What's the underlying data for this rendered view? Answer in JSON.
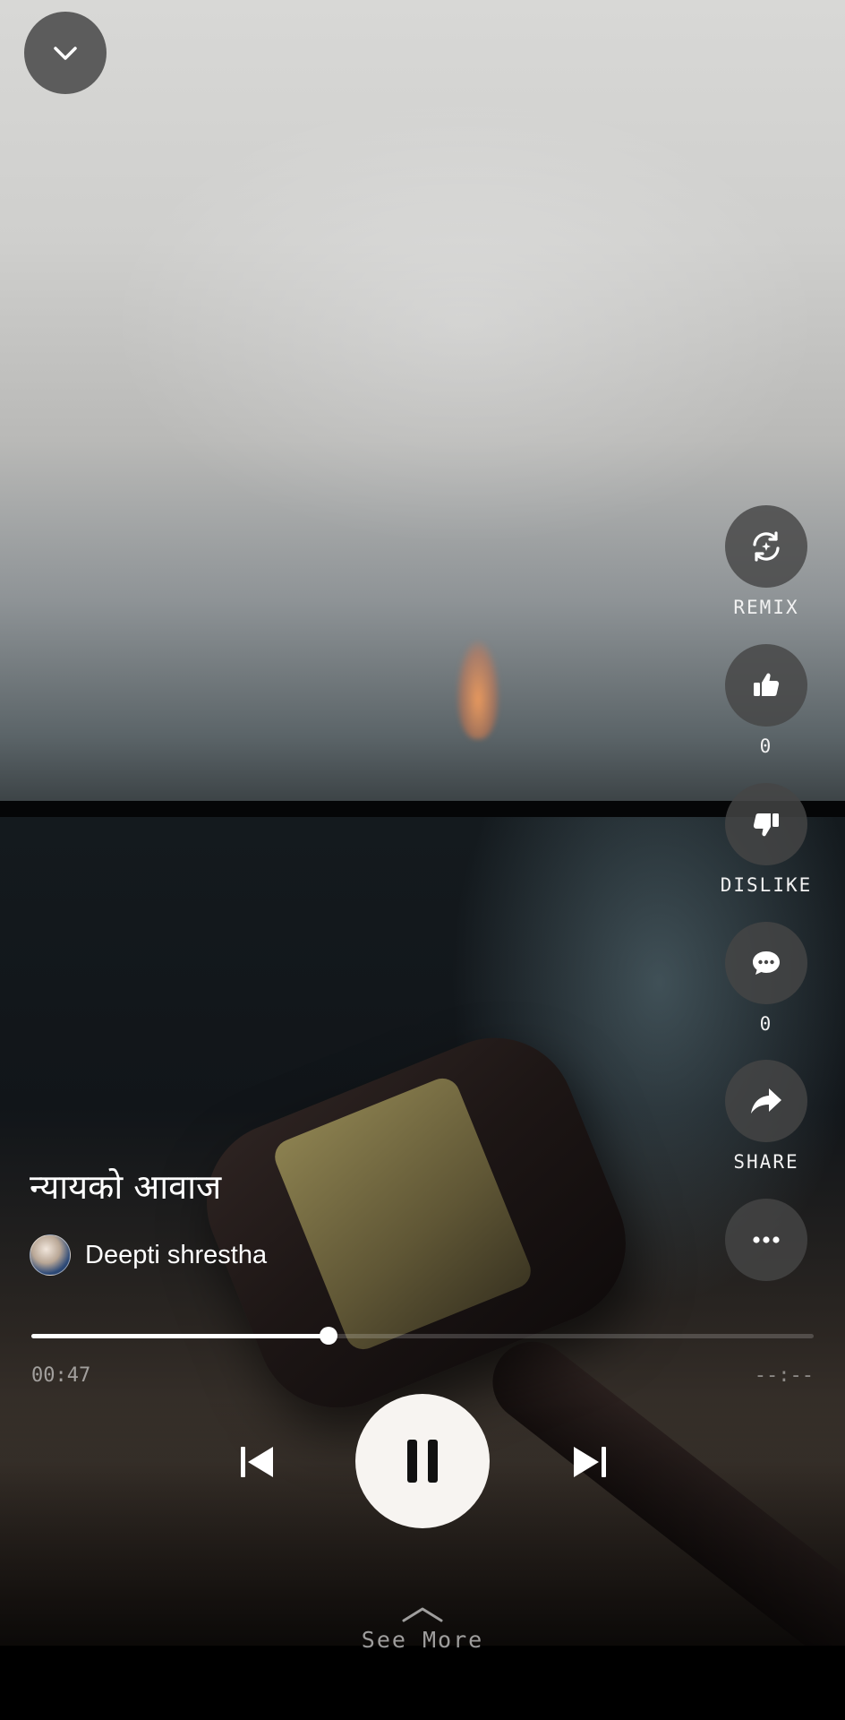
{
  "player": {
    "track_title": "न्यायको आवाज",
    "artist_name": "Deepti shrestha",
    "elapsed": "00:47",
    "total": "--:--",
    "progress_fraction": 0.38
  },
  "actions": {
    "remix_label": "REMIX",
    "like_count": "0",
    "dislike_label": "DISLIKE",
    "comment_count": "0",
    "share_label": "SHARE"
  },
  "footer": {
    "see_more_label": "See More"
  },
  "icons": {
    "collapse": "chevron-down-icon",
    "remix": "remix-icon",
    "like": "thumbs-up-icon",
    "dislike": "thumbs-down-icon",
    "comment": "comment-icon",
    "share": "share-icon",
    "more": "more-icon",
    "previous": "skip-previous-icon",
    "pause": "pause-icon",
    "next": "skip-next-icon",
    "see_more": "chevron-up-icon"
  },
  "colors": {
    "control_surface": "#f7f4f1",
    "action_circle": "#464646"
  }
}
